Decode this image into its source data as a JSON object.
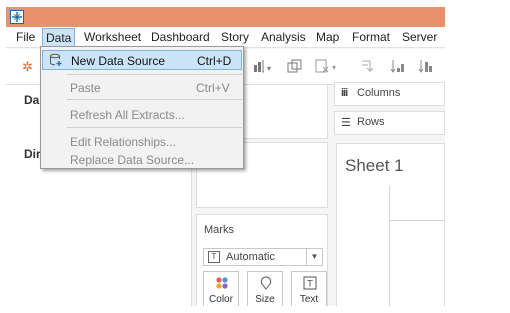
{
  "menubar": {
    "items": [
      {
        "label": "File"
      },
      {
        "label": "Data"
      },
      {
        "label": "Worksheet"
      },
      {
        "label": "Dashboard"
      },
      {
        "label": "Story"
      },
      {
        "label": "Analysis"
      },
      {
        "label": "Map"
      },
      {
        "label": "Format"
      },
      {
        "label": "Server"
      }
    ]
  },
  "data_menu": {
    "items": [
      {
        "label": "New Data Source",
        "shortcut": "Ctrl+D",
        "icon": "add-datasource-icon",
        "state": "highlighted"
      },
      {
        "label": "Paste",
        "shortcut": "Ctrl+V",
        "state": "disabled"
      },
      {
        "label": "Refresh All Extracts...",
        "shortcut": "",
        "state": "disabled"
      },
      {
        "label": "Edit Relationships...",
        "shortcut": "",
        "state": "disabled"
      },
      {
        "label": "Replace Data Source...",
        "shortcut": "",
        "state": "disabled"
      }
    ]
  },
  "left_pane": {
    "data_label_partial": "Da",
    "dimensions_label_partial": "Dir"
  },
  "shelves": {
    "columns_label": "Columns",
    "rows_label": "Rows",
    "columns_icon": "iii",
    "rows_icon": "☰"
  },
  "sheet": {
    "title": "Sheet 1"
  },
  "marks": {
    "title": "Marks",
    "type": "Automatic",
    "type_icon": "T",
    "buttons": [
      {
        "label": "Color",
        "icon": "color-icon"
      },
      {
        "label": "Size",
        "icon": "size-icon"
      },
      {
        "label": "Text",
        "icon": "text-icon"
      }
    ]
  },
  "colors": {
    "titlebar": "#e8916a",
    "menu_highlight": "#cce4f7",
    "menu_highlight_border": "#7fb3e0"
  }
}
